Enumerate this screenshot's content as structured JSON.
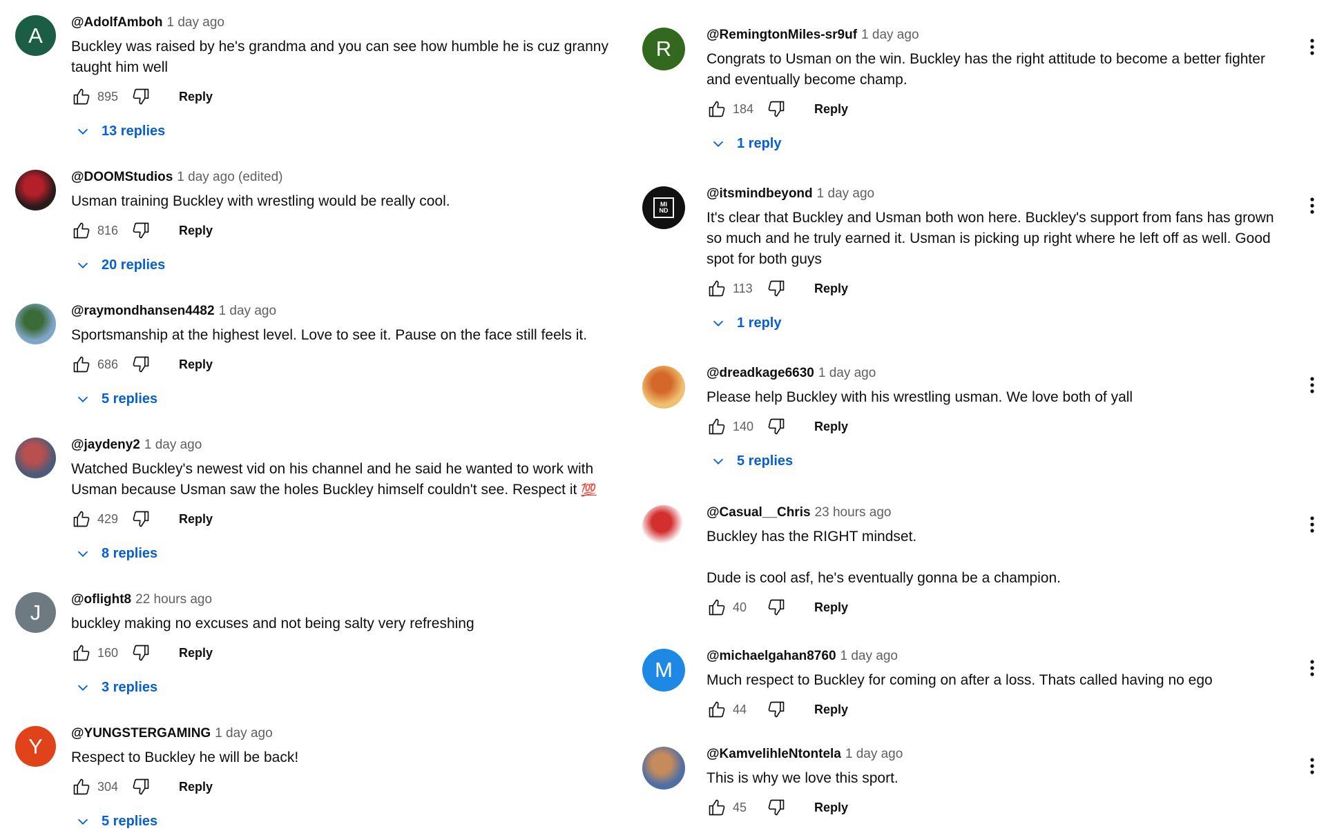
{
  "left": [
    {
      "avatar": {
        "type": "letter",
        "letter": "A",
        "color": "#1b5e45"
      },
      "author": "@AdolfAmboh",
      "time": "1 day ago",
      "text": [
        "Buckley was raised by he's grandma and you can see how humble he is cuz granny taught him well"
      ],
      "likes": "895",
      "reply_label": "Reply",
      "replies": "13 replies"
    },
    {
      "avatar": {
        "type": "image",
        "colors": [
          "#2a1a1a",
          "#b3202a"
        ]
      },
      "author": "@DOOMStudios",
      "time": "1 day ago (edited)",
      "text": [
        "Usman training Buckley with wrestling  would be really cool."
      ],
      "likes": "816",
      "reply_label": "Reply",
      "replies": "20 replies"
    },
    {
      "avatar": {
        "type": "image",
        "colors": [
          "#7fa6c9",
          "#3c6b3a"
        ]
      },
      "author": "@raymondhansen4482",
      "time": "1 day ago",
      "text": [
        "Sportsmanship at the highest level. Love to see it. Pause on the face still feels it."
      ],
      "likes": "686",
      "reply_label": "Reply",
      "replies": "5 replies"
    },
    {
      "avatar": {
        "type": "image",
        "colors": [
          "#4a5a78",
          "#b85050"
        ]
      },
      "author": "@jaydeny2",
      "time": "1 day ago",
      "text": [
        "Watched Buckley's newest vid on his channel and he said he wanted to work with Usman because Usman saw the holes Buckley himself couldn't see. Respect it"
      ],
      "emoji": "💯",
      "likes": "429",
      "reply_label": "Reply",
      "replies": "8 replies"
    },
    {
      "avatar": {
        "type": "letter",
        "letter": "J",
        "color": "#6e7a82"
      },
      "author": "@oflight8",
      "time": "22 hours ago",
      "text": [
        "buckley making no excuses and not being salty very refreshing"
      ],
      "likes": "160",
      "reply_label": "Reply",
      "replies": "3 replies"
    },
    {
      "avatar": {
        "type": "letter",
        "letter": "Y",
        "color": "#e0431a"
      },
      "author": "@YUNGSTERGAMING",
      "time": "1 day ago",
      "text": [
        "Respect to Buckley he will be back!"
      ],
      "likes": "304",
      "reply_label": "Reply",
      "replies": "5 replies"
    }
  ],
  "right": [
    {
      "avatar": {
        "type": "letter",
        "letter": "R",
        "color": "#33691e"
      },
      "author": "@RemingtonMiles-sr9uf",
      "time": "1 day ago",
      "text": [
        "Congrats to Usman on the win. Buckley has the right attitude to become a better fighter and eventually become champ."
      ],
      "likes": "184",
      "reply_label": "Reply",
      "replies": "1 reply"
    },
    {
      "avatar": {
        "type": "badge",
        "letter": "MI ND",
        "color": "#111111"
      },
      "author": "@itsmindbeyond",
      "time": "1 day ago",
      "text": [
        "It's clear that Buckley and Usman both won here. Buckley's support from fans has grown so much and he truly earned it. Usman is picking up right where he left off as well. Good spot for both guys"
      ],
      "likes": "113",
      "reply_label": "Reply",
      "replies": "1 reply"
    },
    {
      "avatar": {
        "type": "image",
        "colors": [
          "#f0c070",
          "#d4682a"
        ]
      },
      "author": "@dreadkage6630",
      "time": "1 day ago",
      "text": [
        "Please help Buckley with his wrestling usman. We love both of yall"
      ],
      "likes": "140",
      "reply_label": "Reply",
      "replies": "5 replies"
    },
    {
      "avatar": {
        "type": "image",
        "colors": [
          "#ffffff",
          "#d32f2f"
        ]
      },
      "author": "@Casual__Chris",
      "time": "23 hours ago",
      "text": [
        "Buckley has the RIGHT mindset.",
        "Dude is cool asf, he's eventually gonna be a champion."
      ],
      "likes": "40",
      "reply_label": "Reply",
      "replies": ""
    },
    {
      "avatar": {
        "type": "letter",
        "letter": "M",
        "color": "#1e88e5"
      },
      "author": "@michaelgahan8760",
      "time": "1 day ago",
      "text": [
        "Much respect to Buckley for coming on after a loss. Thats called having no ego"
      ],
      "likes": "44",
      "reply_label": "Reply",
      "replies": ""
    },
    {
      "avatar": {
        "type": "image",
        "colors": [
          "#4d6ea6",
          "#c58b5a"
        ]
      },
      "author": "@KamvelihleNtontela",
      "time": "1 day ago",
      "text": [
        "This is why we love this sport."
      ],
      "likes": "45",
      "reply_label": "Reply",
      "replies": ""
    }
  ]
}
